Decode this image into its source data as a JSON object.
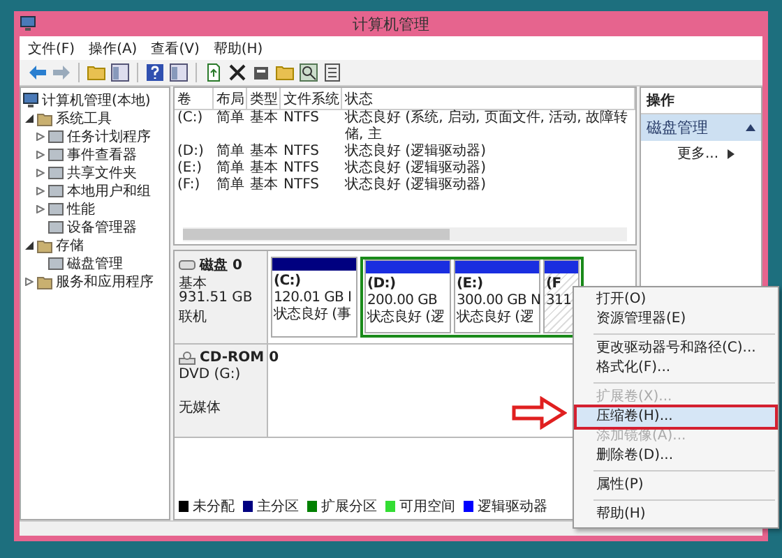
{
  "window": {
    "title": "计算机管理"
  },
  "menu_bar": [
    "文件(F)",
    "操作(A)",
    "查看(V)",
    "帮助(H)"
  ],
  "tree": [
    {
      "label": "计算机管理(本地)",
      "children": [
        {
          "label": "系统工具",
          "expanded": true,
          "children": [
            {
              "label": "任务计划程序",
              "expanded": false
            },
            {
              "label": "事件查看器",
              "expanded": false
            },
            {
              "label": "共享文件夹",
              "expanded": false
            },
            {
              "label": "本地用户和组",
              "expanded": false
            },
            {
              "label": "性能",
              "expanded": false
            },
            {
              "label": "设备管理器"
            }
          ]
        },
        {
          "label": "存储",
          "expanded": true,
          "children": [
            {
              "label": "磁盘管理"
            }
          ]
        },
        {
          "label": "服务和应用程序",
          "expanded": false
        }
      ]
    }
  ],
  "table": {
    "columns": [
      "卷",
      "布局",
      "类型",
      "文件系统",
      "状态"
    ],
    "rows": [
      [
        "(C:)",
        "简单",
        "基本",
        "NTFS",
        "状态良好 (系统, 启动, 页面文件, 活动, 故障转储, 主"
      ],
      [
        "(D:)",
        "简单",
        "基本",
        "NTFS",
        "状态良好 (逻辑驱动器)"
      ],
      [
        "(E:)",
        "简单",
        "基本",
        "NTFS",
        "状态良好 (逻辑驱动器)"
      ],
      [
        "(F:)",
        "简单",
        "基本",
        "NTFS",
        "状态良好 (逻辑驱动器)"
      ]
    ]
  },
  "disks": [
    {
      "kind": "disk",
      "name": "磁盘 0",
      "lines": [
        "基本",
        "931.51 GB",
        "联机"
      ],
      "partitions": [
        {
          "kind": "primary",
          "label": "(C:)",
          "size": "120.01 GB I",
          "status": "状态良好 (事",
          "selected": false
        },
        {
          "kind": "logical",
          "label": "(D:)",
          "size": "200.00 GB",
          "status": "状态良好 (逻",
          "selected": false
        },
        {
          "kind": "logical",
          "label": "(E:)",
          "size": "300.00 GB N",
          "status": "状态良好 (逻",
          "selected": false
        },
        {
          "kind": "logical",
          "label": "(F",
          "size": "311",
          "selected": true
        }
      ]
    },
    {
      "kind": "cdrom",
      "name": "CD-ROM 0",
      "lines": [
        "DVD (G:)",
        "无媒体"
      ]
    }
  ],
  "legend": [
    {
      "label": "未分配",
      "color": "#000000"
    },
    {
      "label": "主分区",
      "color": "#000080"
    },
    {
      "label": "扩展分区",
      "color": "#008000"
    },
    {
      "label": "可用空间",
      "color": "#33dd33"
    },
    {
      "label": "逻辑驱动器",
      "color": "#0000ff"
    }
  ],
  "actions": {
    "header": "操作",
    "section": "磁盘管理",
    "section_expanded": true,
    "items": [
      "更多..."
    ]
  },
  "context_menu": [
    [
      {
        "label": "打开(O)",
        "disabled": false,
        "selected": false
      },
      {
        "label": "资源管理器(E)",
        "disabled": false,
        "selected": false
      }
    ],
    [
      {
        "label": "更改驱动器号和路径(C)...",
        "disabled": false,
        "selected": false
      },
      {
        "label": "格式化(F)...",
        "disabled": false,
        "selected": false
      }
    ],
    [
      {
        "label": "扩展卷(X)...",
        "disabled": true,
        "selected": false
      },
      {
        "label": "压缩卷(H)...",
        "disabled": false,
        "selected": true
      },
      {
        "label": "添加镜像(A)...",
        "disabled": true,
        "selected": false
      },
      {
        "label": "删除卷(D)...",
        "disabled": false,
        "selected": false
      }
    ],
    [
      {
        "label": "属性(P)",
        "disabled": false,
        "selected": false
      }
    ],
    [
      {
        "label": "帮助(H)",
        "disabled": false,
        "selected": false
      }
    ]
  ]
}
